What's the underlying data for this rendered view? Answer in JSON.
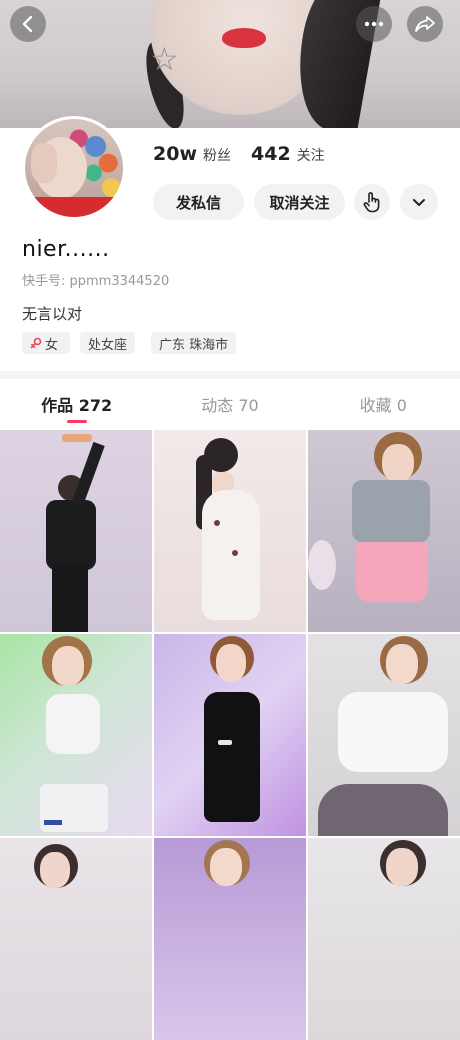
{
  "header": {
    "back_icon": "back-arrow-icon",
    "more_icon": "more-dots-icon",
    "share_icon": "share-icon"
  },
  "profile": {
    "followers_count": "20w",
    "followers_label": "粉丝",
    "following_count": "442",
    "following_label": "关注",
    "message_button": "发私信",
    "unfollow_button": "取消关注",
    "gesture_icon": "hand-pointer-icon",
    "expand_icon": "chevron-down-icon",
    "username": "nier......",
    "user_id": "快手号: ppmm3344520",
    "bio": "无言以对",
    "tags": {
      "gender": "女",
      "gender_icon": "female-icon",
      "zodiac": "处女座",
      "location": "广东 珠海市"
    }
  },
  "tabs": [
    {
      "label": "作品 272"
    },
    {
      "label": "动态 70"
    },
    {
      "label": "收藏 0"
    }
  ],
  "colors": {
    "accent": "#fe3666",
    "gender_icon": "#e8475c"
  }
}
